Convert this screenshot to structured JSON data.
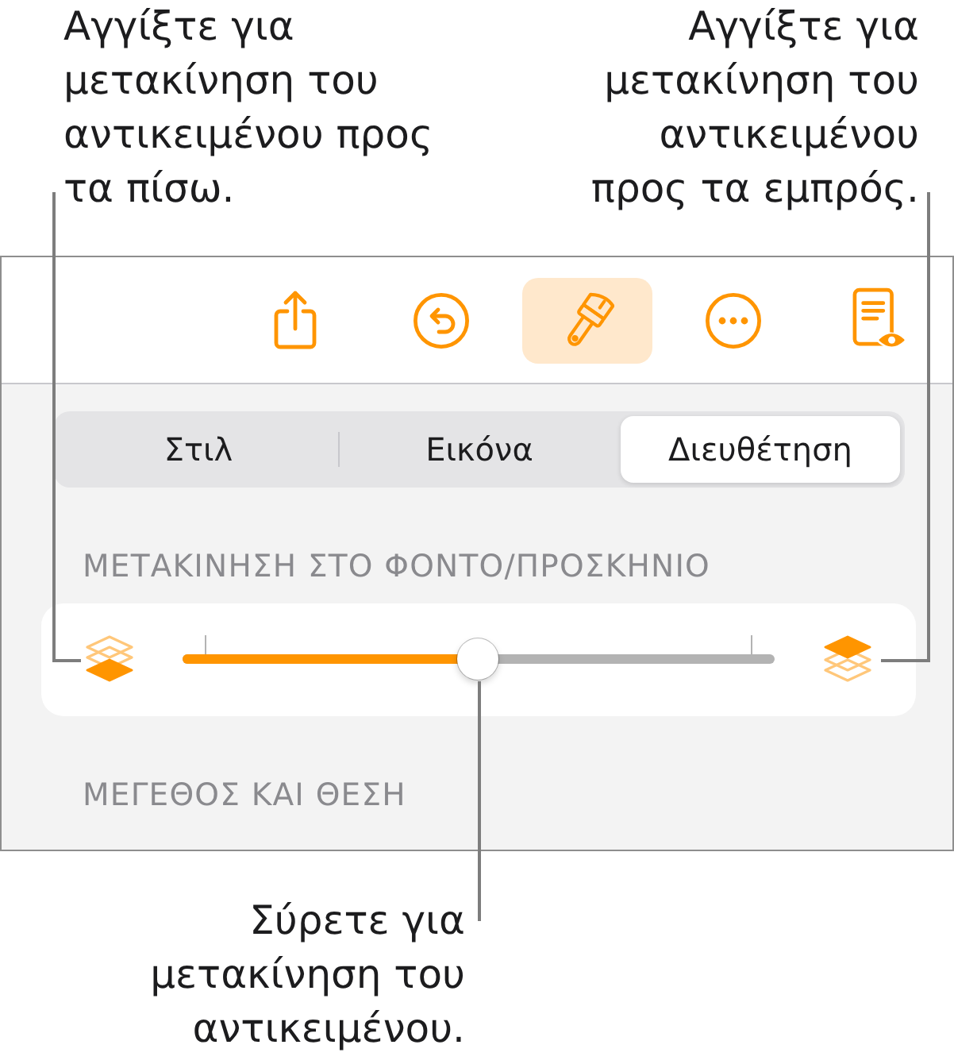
{
  "top_callouts": [
    {
      "text": "Αγγίξτε για μετακίνηση του αντικειμένου προς τα πίσω."
    },
    {
      "text": "Αγγίξτε για μετακίνηση του αντικειμένου προς τα εμπρός."
    }
  ],
  "toolbar": [
    {
      "kind": "share",
      "selected": false
    },
    {
      "kind": "undo",
      "selected": false
    },
    {
      "kind": "format",
      "selected": true
    },
    {
      "kind": "more",
      "selected": false
    },
    {
      "kind": "reader",
      "selected": false
    }
  ],
  "tabs": [
    {
      "label": "Στιλ",
      "selected": false
    },
    {
      "label": "Εικόνα",
      "selected": false
    },
    {
      "label": "Διευθέτηση",
      "selected": true
    }
  ],
  "sections": [
    {
      "title": "ΜΕΤΑΚΙΝΗΣΗ ΣΤΟ ΦΟΝΤΟ/ΠΡΟΣΚΗΝΙΟ",
      "slider": {
        "level": 0.5
      }
    },
    {
      "title": "ΜΕΓΕΘΟΣ ΚΑΙ ΘΕΣΗ"
    }
  ],
  "bottom_callout": {
    "text": "Σύρετε για μετακίνηση του αντικειμένου."
  }
}
